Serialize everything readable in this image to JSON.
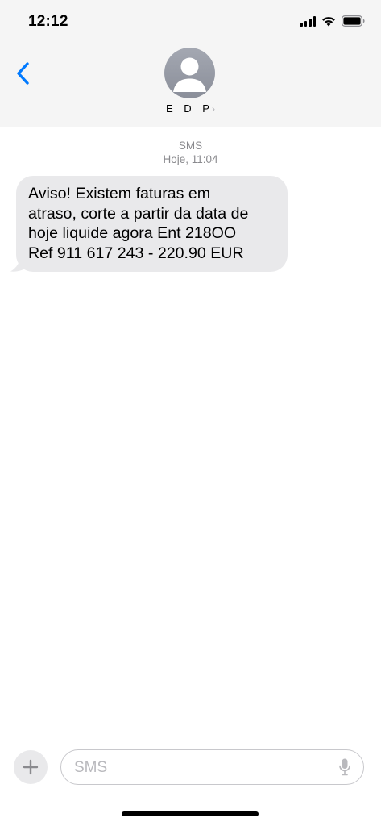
{
  "status_bar": {
    "time": "12:12",
    "signal_icon": "cellular-signal-icon",
    "wifi_icon": "wifi-icon",
    "battery_icon": "battery-icon"
  },
  "header": {
    "back_icon": "chevron-left-icon",
    "avatar_icon": "person-icon",
    "contact_name": "E D P",
    "contact_chevron": "›"
  },
  "conversation": {
    "message_type": "SMS",
    "timestamp": "Hoje, 11:04",
    "messages": [
      {
        "direction": "incoming",
        "lines": [
          "Aviso! Existem faturas em",
          "atraso, corte a partir da data de",
          "hoje liquide agora Ent 218OO",
          "Ref 911 617 243 - 220.90 EUR"
        ]
      }
    ]
  },
  "composer": {
    "plus_icon": "plus-icon",
    "placeholder": "SMS",
    "mic_icon": "microphone-icon"
  },
  "colors": {
    "accent": "#007aff",
    "bubble_incoming": "#e9e9eb",
    "header_bg": "#f5f5f5",
    "meta_text": "#8a8a8e"
  }
}
